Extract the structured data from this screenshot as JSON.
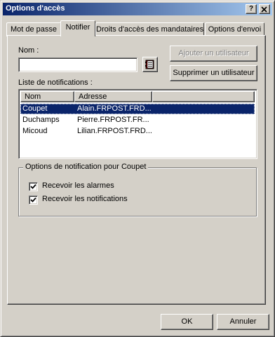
{
  "window": {
    "title": "Options d'accès",
    "help_glyph": "?",
    "close_glyph": "×"
  },
  "tabs": [
    {
      "label": "Mot de passe",
      "active": false
    },
    {
      "label": "Notifier",
      "active": true
    },
    {
      "label": "Droits d'accès des mandataires",
      "active": false
    },
    {
      "label": "Options d'envoi",
      "active": false
    }
  ],
  "notifier": {
    "name_label": "Nom :",
    "name_value": "",
    "address_book_icon": "address-book-icon",
    "add_user_button": "Ajouter un utilisateur",
    "remove_user_button": "Supprimer un utilisateur",
    "list_label": "Liste de notifications :",
    "columns": [
      "Nom",
      "Adresse"
    ],
    "rows": [
      {
        "name": "Coupet",
        "address": "Alain.FRPOST.FRD...",
        "selected": true
      },
      {
        "name": "Duchamps",
        "address": "Pierre.FRPOST.FR...",
        "selected": false
      },
      {
        "name": "Micoud",
        "address": "Lilian.FRPOST.FRD...",
        "selected": false
      }
    ],
    "group_title": "Options de notification pour Coupet",
    "checkboxes": [
      {
        "label": "Recevoir les alarmes",
        "checked": true
      },
      {
        "label": "Recevoir les notifications",
        "checked": true
      }
    ]
  },
  "footer": {
    "ok_label": "OK",
    "cancel_label": "Annuler"
  },
  "colors": {
    "selection": "#0a246a",
    "face": "#d4d0c8",
    "title_gradient_start": "#0a246a",
    "title_gradient_end": "#a6caf0"
  }
}
